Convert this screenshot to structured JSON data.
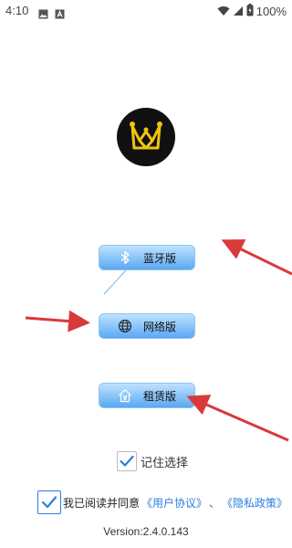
{
  "status_bar": {
    "time": "4:10",
    "battery_percent": "100%",
    "icons": [
      "gallery-icon",
      "app-notification-icon",
      "wifi-icon",
      "signal-icon",
      "battery-icon"
    ]
  },
  "logo": {
    "icon": "crown-m-logo-icon",
    "colors": {
      "background": "#111111",
      "mark": "#f1c40f"
    }
  },
  "modes": [
    {
      "label": "蓝牙版",
      "icon": "bluetooth-icon"
    },
    {
      "label": "网络版",
      "icon": "globe-icon"
    },
    {
      "label": "租赁版",
      "icon": "house-yuan-icon"
    }
  ],
  "remember": {
    "label": "记住选择",
    "checked": true
  },
  "agreement": {
    "checked": true,
    "prefix": "我已阅读并同意",
    "user_agreement": "《用户协议》",
    "separator": "、",
    "privacy_policy": "《隐私政策》"
  },
  "version": "Version:2.4.0.143",
  "colors": {
    "link": "#2a7de0",
    "button_top": "#bfe2ff",
    "button_bottom": "#5aa8f2",
    "annotation_arrow": "#d83a3a"
  }
}
